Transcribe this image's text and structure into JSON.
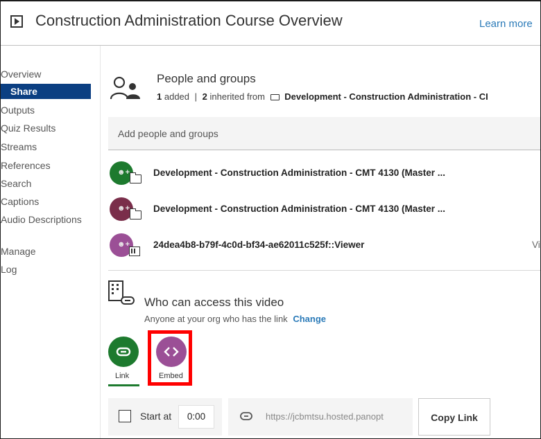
{
  "header": {
    "title": "Construction Administration Course Overview",
    "learn_more": "Learn more"
  },
  "sidebar": {
    "items": [
      {
        "label": "Overview"
      },
      {
        "label": "Share",
        "active": true
      },
      {
        "label": "Outputs"
      },
      {
        "label": "Quiz Results"
      },
      {
        "label": "Streams"
      },
      {
        "label": "References"
      },
      {
        "label": "Search"
      },
      {
        "label": "Captions"
      },
      {
        "label": "Audio Descriptions"
      },
      {
        "label": "Manage"
      },
      {
        "label": "Log"
      }
    ]
  },
  "people": {
    "title": "People and groups",
    "added_count": "1",
    "added_label": "added",
    "separator": "|",
    "inherited_count": "2",
    "inherited_label": "inherited from",
    "inherited_folder": "Development - Construction Administration - CI",
    "add_placeholder": "Add people and groups",
    "entries": [
      {
        "name": "Development - Construction Administration - CMT 4130 (Master ...",
        "avatar_color": "#1d7a2e",
        "badge": "folder-icon",
        "role": ""
      },
      {
        "name": "Development - Construction Administration - CMT 4130 (Master ...",
        "avatar_color": "#7a2e4a",
        "badge": "folder-icon",
        "role": ""
      },
      {
        "name": "24dea4b8-b79f-4c0d-bf34-ae62011c525f::Viewer",
        "avatar_color": "#9b4f96",
        "badge": "building-icon",
        "role": "Vi"
      }
    ]
  },
  "access": {
    "title": "Who can access this video",
    "description": "Anyone at your org who has the link",
    "change_label": "Change"
  },
  "share_modes": {
    "link_label": "Link",
    "embed_label": "Embed",
    "selected": "Link",
    "link_color": "#1d7a2e",
    "embed_color": "#9b4f96",
    "highlight_color": "#ff0000"
  },
  "link_options": {
    "start_at_label": "Start at",
    "start_time": "0:00",
    "url": "https://jcbmtsu.hosted.panopt",
    "copy_label": "Copy Link"
  }
}
